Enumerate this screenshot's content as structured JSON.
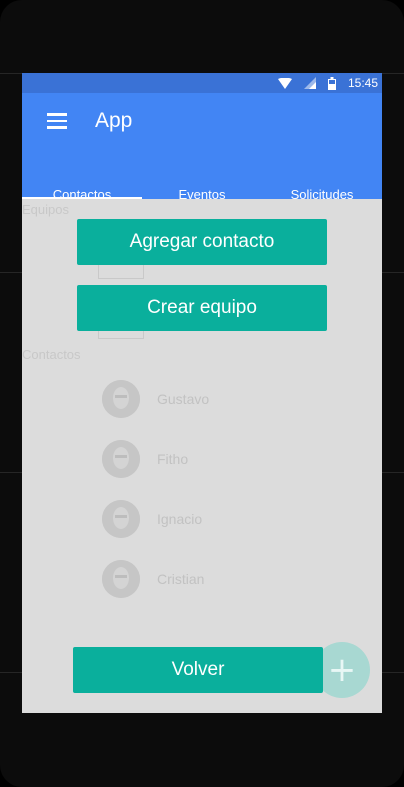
{
  "statusbar": {
    "time": "15:45",
    "icons": [
      "wifi-icon",
      "signal-icon",
      "battery-icon"
    ]
  },
  "appbar": {
    "title": "App",
    "menu_icon": "hamburger-menu-icon"
  },
  "tabs": [
    {
      "label": "Contactos"
    },
    {
      "label": "Eventos"
    },
    {
      "label": "Solicitudes"
    }
  ],
  "sections": {
    "teams_label": "Equipos",
    "contacts_label": "Contactos"
  },
  "contacts": [
    {
      "name": "Gustavo"
    },
    {
      "name": "Fitho"
    },
    {
      "name": "Ignacio"
    },
    {
      "name": "Cristian"
    }
  ],
  "dialog": {
    "add_contact_label": "Agregar contacto",
    "create_team_label": "Crear equipo",
    "back_label": "Volver"
  },
  "fab": {
    "icon": "plus-icon",
    "glyph": "+"
  },
  "colors": {
    "primary": "#4285f4",
    "status_bar": "#3a72d6",
    "accent_button": "#0aaf9c",
    "overlay_background": "#dcdcdc"
  }
}
